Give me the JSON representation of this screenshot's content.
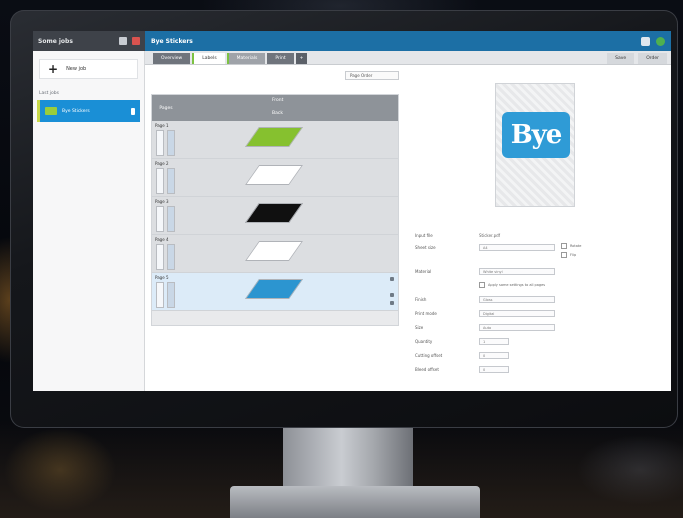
{
  "app": {
    "sidebar_title": "Some jobs",
    "job_title": "Bye Stickers"
  },
  "sidebar": {
    "new_job_label": "New job",
    "section_label": "Last jobs",
    "jobs": [
      {
        "label": "Bye Stickers"
      }
    ]
  },
  "tabs": {
    "items": [
      {
        "label": "Overview"
      },
      {
        "label": "Labels"
      },
      {
        "label": "Materials"
      },
      {
        "label": "Print"
      }
    ],
    "add_label": "+",
    "right_buttons": [
      {
        "label": "Save"
      },
      {
        "label": "Order"
      }
    ]
  },
  "sort": {
    "label": "Page Order"
  },
  "pages": {
    "head": {
      "col1": "Pages",
      "col2": "Front",
      "col3": "Back"
    },
    "rows": [
      {
        "label": "Page 1",
        "color": "#86c12f"
      },
      {
        "label": "Page 2",
        "color": "#ffffff"
      },
      {
        "label": "Page 3",
        "color": "#101010"
      },
      {
        "label": "Page 4",
        "color": "#ffffff"
      },
      {
        "label": "Page 5",
        "color": "#2c95d0"
      }
    ]
  },
  "preview": {
    "logo_text": "Bye"
  },
  "properties": {
    "rows": [
      {
        "label": "Input file",
        "value": "Sticker.pdf"
      },
      {
        "label": "Sheet size",
        "value": "A4"
      },
      {
        "label": "Material",
        "value": "White vinyl"
      },
      {
        "label": "Finish",
        "value": "Gloss"
      },
      {
        "label": "Print mode",
        "value": "Digital"
      },
      {
        "label": "Size",
        "value": "Auto"
      },
      {
        "label": "Quantity",
        "value": "1"
      },
      {
        "label": "Cutting offset",
        "value": "0"
      },
      {
        "label": "Bleed offset",
        "value": "0"
      }
    ],
    "check_a": "Rotate",
    "check_b": "Flip",
    "check_c": "Apply same settings to all pages"
  },
  "colors": {
    "topbar_dark": "#3e4249",
    "topbar_blue": "#1c6fa5",
    "accent_blue": "#1a8fd6",
    "accent_green": "#7cc242"
  }
}
